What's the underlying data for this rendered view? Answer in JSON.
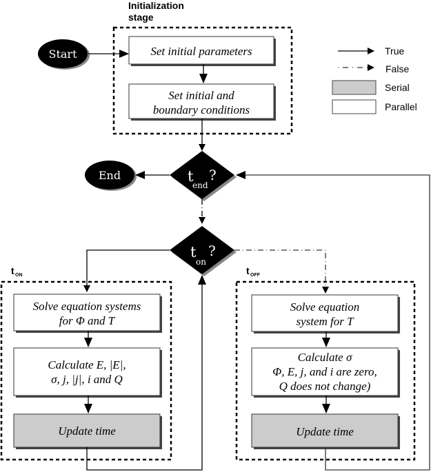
{
  "stage_label": {
    "line1": "Initialization",
    "line2": "stage"
  },
  "nodes": {
    "start": "Start",
    "end": "End",
    "set_params": "Set initial parameters",
    "set_conditions": {
      "line1": "Set initial and",
      "line2": "boundary conditions"
    },
    "t_end": {
      "main": "t",
      "sub": "end",
      "q": "?"
    },
    "t_on": {
      "main": "t",
      "sub": "on",
      "q": "?"
    }
  },
  "groups": {
    "on": {
      "main": "t",
      "sub": "ON"
    },
    "off": {
      "main": "t",
      "sub": "OFF"
    }
  },
  "on_branch": {
    "solve": {
      "line1": "Solve equation systems",
      "line2": "for Φ and T"
    },
    "calc": {
      "line1": "Calculate E, |E|,",
      "line2": "σ, j, |j|, i and Q"
    },
    "update": "Update time"
  },
  "off_branch": {
    "solve": {
      "line1": "Solve equation",
      "line2": "system for T"
    },
    "calc": {
      "line1": "Calculate σ",
      "line2": "Φ, E, j, and i are zero,",
      "line3": "Q does not change)"
    },
    "update": "Update time"
  },
  "legend": {
    "true_label": "True",
    "false_label": "False",
    "serial_label": "Serial",
    "parallel_label": "Parallel"
  },
  "colors": {
    "serial_fill": "#cccccc",
    "parallel_fill": "#ffffff",
    "node_fill": "#000000",
    "shadow": "#888888"
  }
}
